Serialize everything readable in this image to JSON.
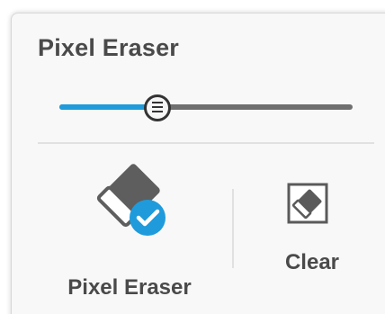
{
  "panel": {
    "title": "Pixel Eraser"
  },
  "slider": {
    "value_percent": 33,
    "accent_color": "#1f9bdb",
    "track_color": "#6f6f6f"
  },
  "tools": {
    "eraser": {
      "label": "Pixel Eraser",
      "icon": "eraser-icon",
      "selected": true,
      "check_icon": "checkmark-badge-icon",
      "badge_color": "#1f9bdb"
    },
    "clear": {
      "label": "Clear",
      "icon": "clear-eraser-icon"
    }
  }
}
